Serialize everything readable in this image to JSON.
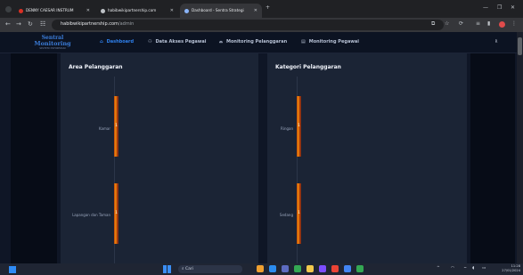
{
  "browser": {
    "tabs": [
      {
        "label": "DENNY CAESAR INSTRUM",
        "color": "#d93025"
      },
      {
        "label": "habibwikipartnership.com",
        "color": "#bdc1c6"
      },
      {
        "label": "Dashboard - Sentra Strategi",
        "color": "#8ab4f8"
      }
    ],
    "new_tab": "+",
    "url_host": "habibwikipartnership.com",
    "url_path": "/admin"
  },
  "app": {
    "logo_line1": "Sentral",
    "logo_line2": "Monitoring",
    "logo_line3": "SISTEM INFORMASI",
    "nav": [
      {
        "label": "Dashboard",
        "active": true
      },
      {
        "label": "Data Akses Pegawai",
        "active": false
      },
      {
        "label": "Monitoring Pelanggaran",
        "active": false
      },
      {
        "label": "Monitoring Pegawai",
        "active": false
      }
    ],
    "avatar": "R"
  },
  "panels": {
    "left": {
      "title": "Area Pelanggaran"
    },
    "right": {
      "title": "Kategori Pelanggaran"
    }
  },
  "chart_data": [
    {
      "type": "bar",
      "orientation": "horizontal",
      "title": "Area Pelanggaran",
      "categories": [
        "Kamar",
        "Lapangan dan Taman"
      ],
      "values": [
        1,
        1
      ],
      "data_labels": [
        "1",
        "1"
      ]
    },
    {
      "type": "bar",
      "orientation": "horizontal",
      "title": "Kategori Pelanggaran",
      "categories": [
        "Ringan",
        "Sedang"
      ],
      "values": [
        1,
        1
      ],
      "data_labels": [
        "1",
        "1"
      ]
    }
  ],
  "taskbar": {
    "search": "Cari",
    "time": "11:28",
    "date": "27/01/2024",
    "icons": [
      "#f0a030",
      "#2b8cf0",
      "#5c6bc0",
      "#34a853",
      "#f2c94c",
      "#7c4dff",
      "#ea4335",
      "#4285f4",
      "#34a853"
    ]
  }
}
